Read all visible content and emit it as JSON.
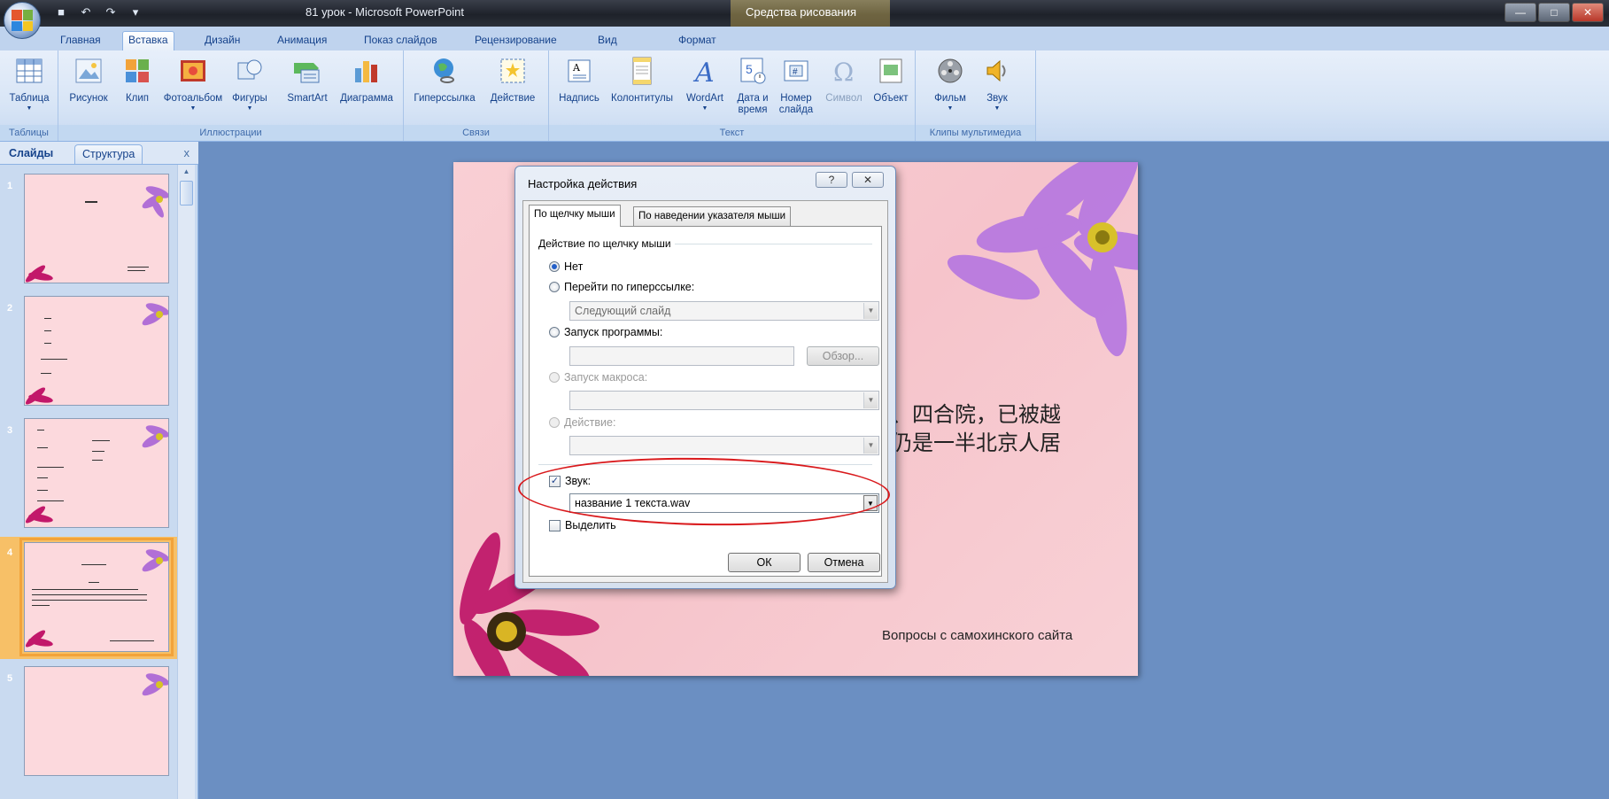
{
  "window": {
    "title": "81 урок - Microsoft PowerPoint",
    "context_title": "Средства рисования",
    "controls": [
      "—",
      "□",
      "✕"
    ]
  },
  "tabs": [
    {
      "label": "Главная",
      "active": false
    },
    {
      "label": "Вставка",
      "active": true
    },
    {
      "label": "Дизайн",
      "active": false
    },
    {
      "label": "Анимация",
      "active": false
    },
    {
      "label": "Показ слайдов",
      "active": false
    },
    {
      "label": "Рецензирование",
      "active": false
    },
    {
      "label": "Вид",
      "active": false
    },
    {
      "label": "Формат",
      "active": false
    }
  ],
  "ribbon": {
    "groups": {
      "tables": "Таблицы",
      "illustrations": "Иллюстрации",
      "links": "Связи",
      "text": "Текст",
      "media": "Клипы мультимедиа"
    },
    "buttons": {
      "table": "Таблица",
      "picture": "Рисунок",
      "clip": "Клип",
      "photoalbum": "Фотоальбом",
      "shapes": "Фигуры",
      "smartart": "SmartArt",
      "chart": "Диаграмма",
      "hyperlink": "Гиперссылка",
      "action": "Действие",
      "textbox": "Надпись",
      "headerfooter": "Колонтитулы",
      "wordart": "WordArt",
      "datetime_1": "Дата и",
      "datetime_2": "время",
      "slidenum_1": "Номер",
      "slidenum_2": "слайда",
      "symbol": "Символ",
      "object": "Объект",
      "movie": "Фильм",
      "sound": "Звук"
    }
  },
  "pane": {
    "tab_slides": "Слайды",
    "tab_outline": "Структура",
    "close": "x",
    "thumb_numbers": [
      "1",
      "2",
      "3",
      "4",
      "5"
    ]
  },
  "slide": {
    "cn_line1": "、四合院，已被越",
    "cn_line2": "仍是一半北京人居",
    "footer": "Вопросы с самохинского сайта"
  },
  "dialog": {
    "title": "Настройка действия",
    "help": "?",
    "close": "✕",
    "tab_click": "По щелчку мыши",
    "tab_hover": "По наведении указателя мыши",
    "section": "Действие по щелчку мыши",
    "opt_none": "Нет",
    "opt_hyperlink": "Перейти по гиперссылке:",
    "hyperlink_value": "Следующий слайд",
    "opt_program": "Запуск программы:",
    "browse": "Обзор...",
    "opt_macro": "Запуск макроса:",
    "opt_action": "Действие:",
    "sound_label": "Звук:",
    "sound_checked": true,
    "sound_value": "название 1 текста.wav",
    "highlight_label": "Выделить",
    "ok": "ОК",
    "cancel": "Отмена"
  }
}
